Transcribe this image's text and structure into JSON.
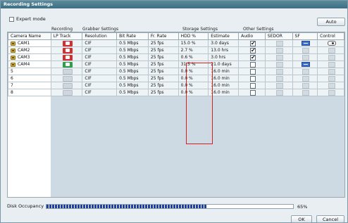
{
  "window": {
    "title": "Recording Settings"
  },
  "expert_mode": {
    "label": "Expert mode",
    "checked": false
  },
  "auto_button": "Auto",
  "groups": {
    "recording": "Recording",
    "grabber": "Grabber Settings",
    "storage": "Storage Settings",
    "other": "Other Settings"
  },
  "columns": [
    "Camera Name",
    "LP Track",
    "Resolution",
    "Bit Rate",
    "Fr. Rate",
    "HDD %",
    "Estimate",
    "Audio",
    "SEDOR",
    "SF",
    "Control"
  ],
  "rows": [
    {
      "name": "CAM1",
      "cam": true,
      "lp": "red",
      "resolution": "CIF",
      "bitrate": "0.5 Mbps",
      "fps": "25 fps",
      "hdd": "15.0 %",
      "estimate": "3.0 days",
      "audio": true,
      "sf": true,
      "control": true
    },
    {
      "name": "CAM2",
      "cam": true,
      "lp": "red",
      "resolution": "CIF",
      "bitrate": "0.5 Mbps",
      "fps": "25 fps",
      "hdd": "2.7 %",
      "estimate": "13.0 hrs",
      "audio": true,
      "sf": false,
      "control": false
    },
    {
      "name": "CAM3",
      "cam": true,
      "lp": "red",
      "resolution": "CIF",
      "bitrate": "0.5 Mbps",
      "fps": "25 fps",
      "hdd": "0.6 %",
      "estimate": "3.0 hrs",
      "audio": true,
      "sf": false,
      "control": false
    },
    {
      "name": "CAM4",
      "cam": true,
      "lp": "green",
      "resolution": "CIF",
      "bitrate": "0.5 Mbps",
      "fps": "25 fps",
      "hdd": "31.5 %",
      "estimate": "21.0 days",
      "audio": false,
      "sf": true,
      "control": false
    },
    {
      "name": "5",
      "cam": false,
      "lp": "grey",
      "resolution": "CIF",
      "bitrate": "0.5 Mbps",
      "fps": "25 fps",
      "hdd": "0.0 %",
      "estimate": "16.0 min",
      "audio": false,
      "sf": false,
      "control": false
    },
    {
      "name": "6",
      "cam": false,
      "lp": "grey",
      "resolution": "CIF",
      "bitrate": "0.5 Mbps",
      "fps": "25 fps",
      "hdd": "0.0 %",
      "estimate": "16.0 min",
      "audio": false,
      "sf": false,
      "control": false
    },
    {
      "name": "7",
      "cam": false,
      "lp": "grey",
      "resolution": "CIF",
      "bitrate": "0.5 Mbps",
      "fps": "25 fps",
      "hdd": "0.0 %",
      "estimate": "16.0 min",
      "audio": false,
      "sf": false,
      "control": false
    },
    {
      "name": "8",
      "cam": false,
      "lp": "grey",
      "resolution": "CIF",
      "bitrate": "0.5 Mbps",
      "fps": "25 fps",
      "hdd": "0.0 %",
      "estimate": "16.0 min",
      "audio": false,
      "sf": false,
      "control": false
    }
  ],
  "disk": {
    "label": "Disk Occupancy",
    "percent_value": 0.65,
    "percent_text": "65%"
  },
  "buttons": {
    "ok": "OK",
    "cancel": "Cancel"
  },
  "colors": {
    "title_bar": "#3c6e82",
    "hdd_highlight": "#d42020",
    "meter_fill": "#1f3fa0"
  }
}
